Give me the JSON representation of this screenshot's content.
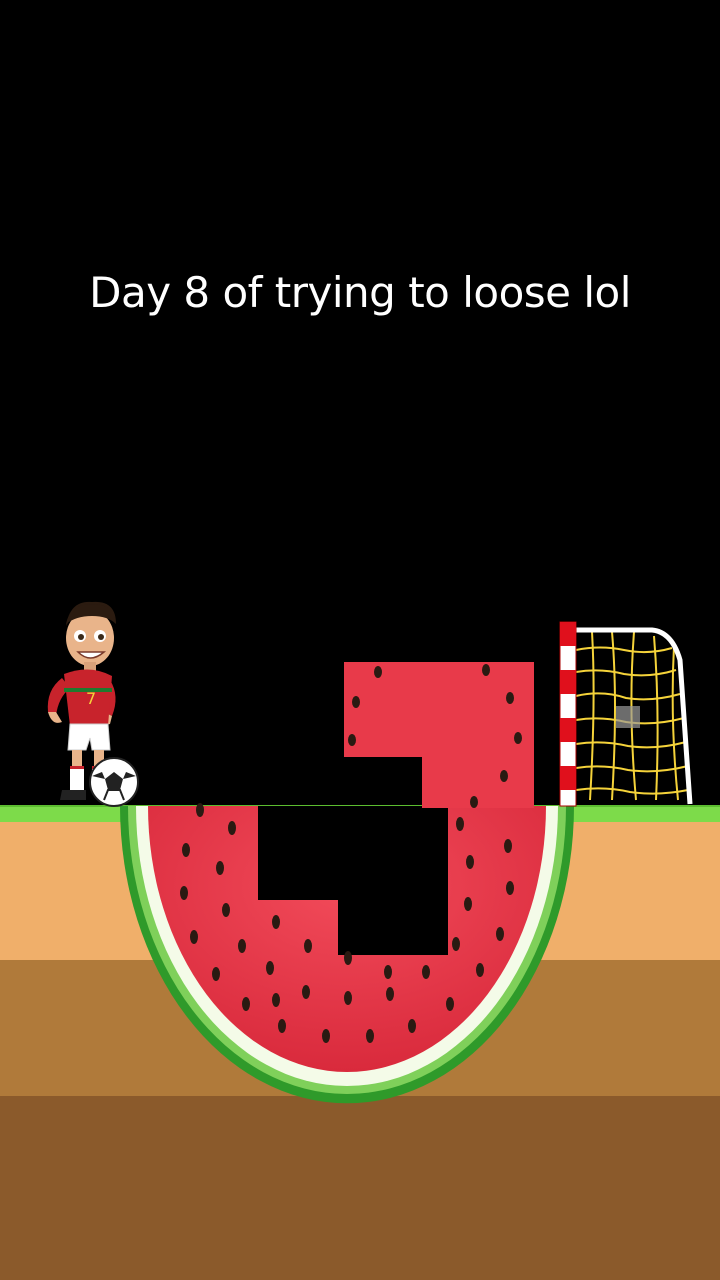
{
  "caption": "Day 8 of trying to loose lol",
  "player": {
    "jersey_number": "7"
  },
  "colors": {
    "grass": "#7ddb4a",
    "sand": "#f0af6a",
    "dirt": "#b07a3a",
    "deep_soil": "#8b5a2b",
    "watermelon_flesh": "#e83a4a",
    "rind": "#2f9a2a",
    "goal_post_red": "#e0101c",
    "net": "#f5d33a"
  }
}
